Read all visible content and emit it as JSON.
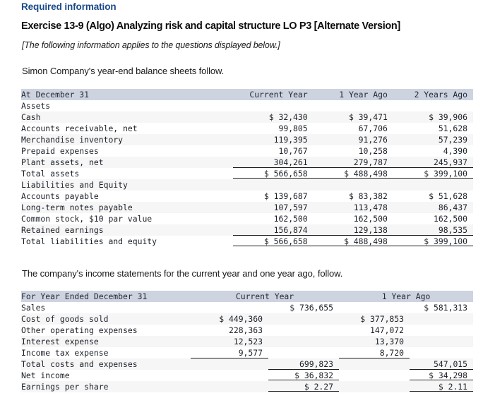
{
  "header": {
    "required_information": "Required information",
    "exercise_title": "Exercise 13-9 (Algo) Analyzing risk and capital structure LO P3 [Alternate Version]",
    "applies_note": "[The following information applies to the questions displayed below.]",
    "intro_balance": "Simon Company's year-end balance sheets follow.",
    "intro_income": "The company's income statements for the current year and one year ago, follow."
  },
  "colors": {
    "heading_blue": "#1a4a8a",
    "table_header_band": "#ced3e0",
    "row_stripe": "#f6f6f6",
    "rule": "#1a1a1a",
    "text": "#1a2028"
  },
  "balance_sheet": {
    "columns": [
      "At December 31",
      "Current Year",
      "1 Year Ago",
      "2 Years Ago"
    ],
    "sections": [
      {
        "heading": "Assets",
        "rows": [
          {
            "label": "Cash",
            "values": [
              "$ 32,430",
              "$ 39,471",
              "$ 39,906"
            ]
          },
          {
            "label": "Accounts receivable, net",
            "values": [
              "99,805",
              "67,706",
              "51,628"
            ]
          },
          {
            "label": "Merchandise inventory",
            "values": [
              "119,395",
              "91,276",
              "57,239"
            ]
          },
          {
            "label": "Prepaid expenses",
            "values": [
              "10,767",
              "10,258",
              "4,390"
            ]
          },
          {
            "label": "Plant assets, net",
            "values": [
              "304,261",
              "279,787",
              "245,937"
            ]
          }
        ],
        "total": {
          "label": "Total assets",
          "values": [
            "$ 566,658",
            "$ 488,498",
            "$ 399,100"
          ]
        }
      },
      {
        "heading": "Liabilities and Equity",
        "rows": [
          {
            "label": "Accounts payable",
            "values": [
              "$ 139,687",
              "$ 83,382",
              "$ 51,628"
            ]
          },
          {
            "label": "Long-term notes payable",
            "values": [
              "107,597",
              "113,478",
              "86,437"
            ]
          },
          {
            "label": "Common stock, $10 par value",
            "values": [
              "162,500",
              "162,500",
              "162,500"
            ]
          },
          {
            "label": "Retained earnings",
            "values": [
              "156,874",
              "129,138",
              "98,535"
            ]
          }
        ],
        "total": {
          "label": "Total liabilities and equity",
          "values": [
            "$ 566,658",
            "$ 488,498",
            "$ 399,100"
          ]
        }
      }
    ]
  },
  "income_statement": {
    "columns": [
      "For Year Ended December 31",
      "Current Year",
      "1 Year Ago"
    ],
    "rows": [
      {
        "label": "Sales",
        "cy_detail": "",
        "cy_total": "$ 736,655",
        "ly_detail": "",
        "ly_total": "$ 581,313"
      },
      {
        "label": "Cost of goods sold",
        "cy_detail": "$ 449,360",
        "cy_total": "",
        "ly_detail": "$ 377,853",
        "ly_total": ""
      },
      {
        "label": "Other operating expenses",
        "cy_detail": "228,363",
        "cy_total": "",
        "ly_detail": "147,072",
        "ly_total": ""
      },
      {
        "label": "Interest expense",
        "cy_detail": "12,523",
        "cy_total": "",
        "ly_detail": "13,370",
        "ly_total": ""
      },
      {
        "label": "Income tax expense",
        "cy_detail": "9,577",
        "cy_total": "",
        "ly_detail": "8,720",
        "ly_total": ""
      },
      {
        "label": "Total costs and expenses",
        "cy_detail": "",
        "cy_total": "699,823",
        "ly_detail": "",
        "ly_total": "547,015"
      },
      {
        "label": "Net income",
        "cy_detail": "",
        "cy_total": "$ 36,832",
        "ly_detail": "",
        "ly_total": "$ 34,298"
      },
      {
        "label": "Earnings per share",
        "cy_detail": "",
        "cy_total": "$ 2.27",
        "ly_detail": "",
        "ly_total": "$ 2.11"
      }
    ]
  }
}
